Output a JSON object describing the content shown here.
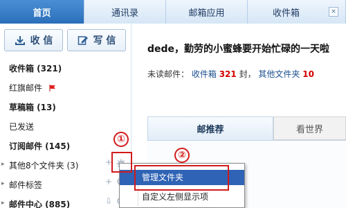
{
  "top_tabs": [
    {
      "label": "首页",
      "active": true
    },
    {
      "label": "通讯录",
      "active": false
    },
    {
      "label": "邮箱应用",
      "active": false
    },
    {
      "label": "收件箱",
      "active": false
    }
  ],
  "top_tab_close": "×",
  "toolbar": {
    "receive_label": "收 信",
    "compose_label": "写 信"
  },
  "folders": [
    "收件箱 (321)",
    "红旗邮件",
    "草稿箱 (13)",
    "已发送",
    "订阅邮件 (145)",
    "其他8个文件夹 (3)",
    "邮件标签",
    "邮件中心 (885)"
  ],
  "greeting": "dede，勤劳的小蜜蜂要开始忙碌的一天啦",
  "unread": {
    "prefix": "未读邮件：",
    "inbox_label": "收件箱",
    "inbox_count": "321",
    "unit": "封，",
    "other_label": "其他文件夹",
    "other_count": "10"
  },
  "content_tabs": [
    "邮推荐",
    "看世界"
  ],
  "context_menu": {
    "items": [
      "管理文件夹",
      "自定义左侧显示项"
    ]
  },
  "annotations": {
    "one": "①",
    "two": "②"
  },
  "colors": {
    "accent": "#2a6fb9",
    "highlight": "#2f63b5",
    "annotation": "#d11a1a",
    "unread_count": "#d40000"
  }
}
